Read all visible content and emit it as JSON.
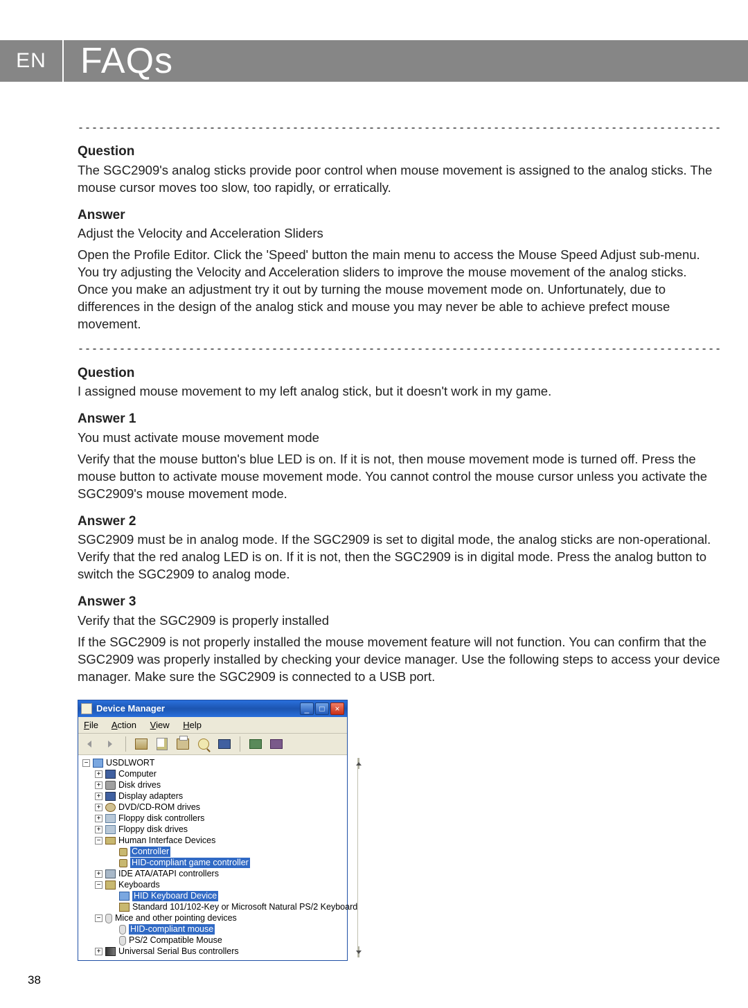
{
  "header": {
    "lang": "EN",
    "title": "FAQs"
  },
  "faq1": {
    "q_label": "Question",
    "q_text": "The SGC2909's analog sticks provide poor control when mouse movement is assigned to the analog sticks. The mouse cursor moves too slow, too rapidly, or erratically.",
    "a_label": "Answer",
    "a_line1": "Adjust the Velocity and Acceleration Sliders",
    "a_text": "Open the Profile Editor. Click the 'Speed' button the main menu to access the Mouse Speed Adjust sub-menu. You try adjusting the Velocity and Acceleration sliders to improve the mouse movement of the analog sticks. Once you make an adjustment try it out by turning the mouse movement mode on. Unfortunately, due to differences in the design of the analog stick and mouse you may never be able to achieve prefect mouse movement."
  },
  "faq2": {
    "q_label": "Question",
    "q_text": "I assigned mouse movement to my left analog stick, but it doesn't work in my game.",
    "a1_label": "Answer 1",
    "a1_line1": "You must activate mouse movement mode",
    "a1_text": "Verify that the mouse button's blue LED is on. If it is not, then mouse movement mode is turned off. Press the mouse button to activate mouse movement mode. You cannot control the mouse cursor unless you activate the SGC2909's mouse movement mode.",
    "a2_label": "Answer 2",
    "a2_text": "SGC2909 must be in analog mode. If the SGC2909 is set to digital mode, the analog sticks are non-operational. Verify that the red analog LED is on. If it is not, then the SGC2909 is in digital mode. Press the analog button to switch the SGC2909 to analog mode.",
    "a3_label": "Answer 3",
    "a3_line1": "Verify that the SGC2909 is properly installed",
    "a3_text": "If the SGC2909 is not properly installed the mouse movement feature will not function. You can confirm that the SGC2909 was properly installed by checking your device manager. Use the following steps to access your device manager. Make sure the SGC2909 is connected to a USB port."
  },
  "dm": {
    "title": "Device Manager",
    "menu": {
      "file": "File",
      "action": "Action",
      "view": "View",
      "help": "Help"
    },
    "tree": {
      "root": "USDLWORT",
      "computer": "Computer",
      "disk": "Disk drives",
      "display": "Display adapters",
      "dvd": "DVD/CD-ROM drives",
      "floppyctrl": "Floppy disk controllers",
      "floppy": "Floppy disk drives",
      "hid": "Human Interface Devices",
      "controller": "Controller",
      "hidgame": "HID-compliant game controller",
      "ide": "IDE ATA/ATAPI controllers",
      "keyboards": "Keyboards",
      "hidkbd": "HID Keyboard Device",
      "stdkbd": "Standard 101/102-Key or Microsoft Natural PS/2 Keyboard",
      "mice": "Mice and other pointing devices",
      "hidmouse": "HID-compliant mouse",
      "ps2mouse": "PS/2 Compatible Mouse",
      "usb": "Universal Serial Bus controllers"
    }
  },
  "page_number": "38"
}
